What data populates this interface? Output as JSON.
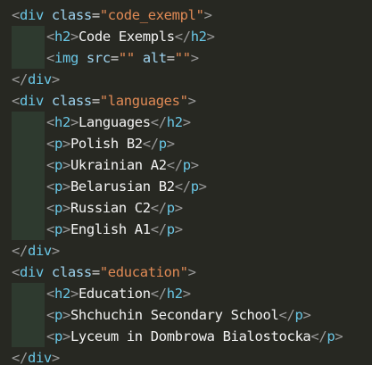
{
  "editor": {
    "lines": [
      {
        "indent": false,
        "parts": [
          {
            "t": "br",
            "v": "<"
          },
          {
            "t": "tag",
            "v": "div"
          },
          {
            "t": "txt",
            "v": " "
          },
          {
            "t": "attr",
            "v": "class"
          },
          {
            "t": "eq",
            "v": "="
          },
          {
            "t": "str",
            "v": "\"code_exempl\""
          },
          {
            "t": "br",
            "v": ">"
          }
        ]
      },
      {
        "indent": true,
        "parts": [
          {
            "t": "br",
            "v": "<"
          },
          {
            "t": "tag",
            "v": "h2"
          },
          {
            "t": "br",
            "v": ">"
          },
          {
            "t": "txt",
            "v": "Code Exempls"
          },
          {
            "t": "br",
            "v": "</"
          },
          {
            "t": "tag",
            "v": "h2"
          },
          {
            "t": "br",
            "v": ">"
          }
        ]
      },
      {
        "indent": true,
        "parts": [
          {
            "t": "br",
            "v": "<"
          },
          {
            "t": "tag",
            "v": "img"
          },
          {
            "t": "txt",
            "v": " "
          },
          {
            "t": "attr",
            "v": "src"
          },
          {
            "t": "eq",
            "v": "="
          },
          {
            "t": "str",
            "v": "\"\""
          },
          {
            "t": "txt",
            "v": " "
          },
          {
            "t": "attr",
            "v": "alt"
          },
          {
            "t": "eq",
            "v": "="
          },
          {
            "t": "str",
            "v": "\"\""
          },
          {
            "t": "br",
            "v": ">"
          }
        ]
      },
      {
        "indent": false,
        "parts": [
          {
            "t": "br",
            "v": "</"
          },
          {
            "t": "tag",
            "v": "div"
          },
          {
            "t": "br",
            "v": ">"
          }
        ]
      },
      {
        "indent": false,
        "parts": [
          {
            "t": "br",
            "v": "<"
          },
          {
            "t": "tag",
            "v": "div"
          },
          {
            "t": "txt",
            "v": " "
          },
          {
            "t": "attr",
            "v": "class"
          },
          {
            "t": "eq",
            "v": "="
          },
          {
            "t": "str",
            "v": "\"languages\""
          },
          {
            "t": "br",
            "v": ">"
          }
        ]
      },
      {
        "indent": true,
        "parts": [
          {
            "t": "br",
            "v": "<"
          },
          {
            "t": "tag",
            "v": "h2"
          },
          {
            "t": "br",
            "v": ">"
          },
          {
            "t": "txt",
            "v": "Languages"
          },
          {
            "t": "br",
            "v": "</"
          },
          {
            "t": "tag",
            "v": "h2"
          },
          {
            "t": "br",
            "v": ">"
          }
        ]
      },
      {
        "indent": true,
        "parts": [
          {
            "t": "br",
            "v": "<"
          },
          {
            "t": "tag",
            "v": "p"
          },
          {
            "t": "br",
            "v": ">"
          },
          {
            "t": "txt",
            "v": "Polish B2"
          },
          {
            "t": "br",
            "v": "</"
          },
          {
            "t": "tag",
            "v": "p"
          },
          {
            "t": "br",
            "v": ">"
          }
        ]
      },
      {
        "indent": true,
        "parts": [
          {
            "t": "br",
            "v": "<"
          },
          {
            "t": "tag",
            "v": "p"
          },
          {
            "t": "br",
            "v": ">"
          },
          {
            "t": "txt",
            "v": "Ukrainian A2"
          },
          {
            "t": "br",
            "v": "</"
          },
          {
            "t": "tag",
            "v": "p"
          },
          {
            "t": "br",
            "v": ">"
          }
        ]
      },
      {
        "indent": true,
        "parts": [
          {
            "t": "br",
            "v": "<"
          },
          {
            "t": "tag",
            "v": "p"
          },
          {
            "t": "br",
            "v": ">"
          },
          {
            "t": "txt",
            "v": "Belarusian B2"
          },
          {
            "t": "br",
            "v": "</"
          },
          {
            "t": "tag",
            "v": "p"
          },
          {
            "t": "br",
            "v": ">"
          }
        ]
      },
      {
        "indent": true,
        "parts": [
          {
            "t": "br",
            "v": "<"
          },
          {
            "t": "tag",
            "v": "p"
          },
          {
            "t": "br",
            "v": ">"
          },
          {
            "t": "txt",
            "v": "Russian C2"
          },
          {
            "t": "br",
            "v": "</"
          },
          {
            "t": "tag",
            "v": "p"
          },
          {
            "t": "br",
            "v": ">"
          }
        ]
      },
      {
        "indent": true,
        "parts": [
          {
            "t": "br",
            "v": "<"
          },
          {
            "t": "tag",
            "v": "p"
          },
          {
            "t": "br",
            "v": ">"
          },
          {
            "t": "txt",
            "v": "English A1"
          },
          {
            "t": "br",
            "v": "</"
          },
          {
            "t": "tag",
            "v": "p"
          },
          {
            "t": "br",
            "v": ">"
          }
        ]
      },
      {
        "indent": false,
        "parts": [
          {
            "t": "br",
            "v": "</"
          },
          {
            "t": "tag",
            "v": "div"
          },
          {
            "t": "br",
            "v": ">"
          }
        ]
      },
      {
        "indent": false,
        "parts": [
          {
            "t": "br",
            "v": "<"
          },
          {
            "t": "tag",
            "v": "div"
          },
          {
            "t": "txt",
            "v": " "
          },
          {
            "t": "attr",
            "v": "class"
          },
          {
            "t": "eq",
            "v": "="
          },
          {
            "t": "str",
            "v": "\"education\""
          },
          {
            "t": "br",
            "v": ">"
          }
        ]
      },
      {
        "indent": true,
        "parts": [
          {
            "t": "br",
            "v": "<"
          },
          {
            "t": "tag",
            "v": "h2"
          },
          {
            "t": "br",
            "v": ">"
          },
          {
            "t": "txt",
            "v": "Education"
          },
          {
            "t": "br",
            "v": "</"
          },
          {
            "t": "tag",
            "v": "h2"
          },
          {
            "t": "br",
            "v": ">"
          }
        ]
      },
      {
        "indent": true,
        "parts": [
          {
            "t": "br",
            "v": "<"
          },
          {
            "t": "tag",
            "v": "p"
          },
          {
            "t": "br",
            "v": ">"
          },
          {
            "t": "txt",
            "v": "Shchuchin Secondary School"
          },
          {
            "t": "br",
            "v": "</"
          },
          {
            "t": "tag",
            "v": "p"
          },
          {
            "t": "br",
            "v": ">"
          }
        ]
      },
      {
        "indent": true,
        "parts": [
          {
            "t": "br",
            "v": "<"
          },
          {
            "t": "tag",
            "v": "p"
          },
          {
            "t": "br",
            "v": ">"
          },
          {
            "t": "txt",
            "v": "Lyceum in Dombrowa Bialostocka"
          },
          {
            "t": "br",
            "v": "</"
          },
          {
            "t": "tag",
            "v": "p"
          },
          {
            "t": "br",
            "v": ">"
          }
        ]
      },
      {
        "indent": false,
        "parts": [
          {
            "t": "br",
            "v": "</"
          },
          {
            "t": "tag",
            "v": "div"
          },
          {
            "t": "br",
            "v": ">"
          }
        ]
      }
    ]
  },
  "colors": {
    "background": "#272822",
    "indent_guide": "#2e3a2f",
    "bracket": "#9a9a9a",
    "tag": "#6ac7e6",
    "attribute": "#9fd4f0",
    "string": "#e08a55",
    "text": "#f3f3f3"
  }
}
